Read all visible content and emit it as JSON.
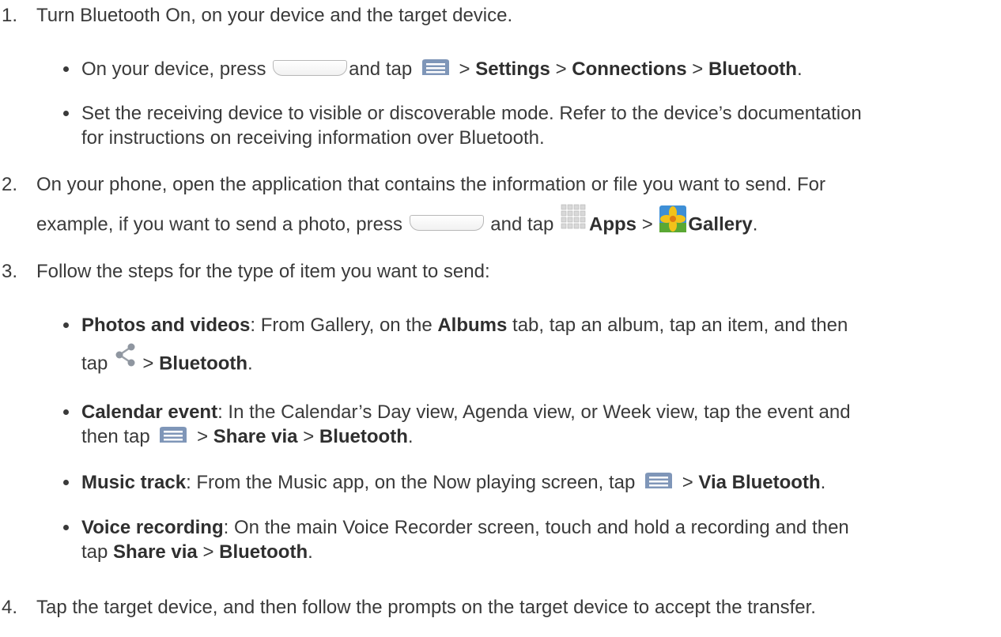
{
  "steps": [
    {
      "num": "1.",
      "text": "Turn Bluetooth On, on your device and the target device."
    },
    {
      "num": "2.",
      "line1": "On your phone, open the application that contains the information or file you want to send. For",
      "line2_a": "example, if you want to send a photo, press",
      "line2_b": "and tap",
      "apps": "Apps",
      "sep": ">",
      "gallery": "Gallery",
      "end": "."
    },
    {
      "num": "3.",
      "text": "Follow the steps for the type of item you want to send:"
    },
    {
      "num": "4.",
      "text": "Tap the target device, and then follow the prompts on the target device to accept the transfer."
    }
  ],
  "step1_bullets": {
    "b1": {
      "a": "On your device, press",
      "b": "and tap",
      "c": ">",
      "settings": "Settings",
      "d": ">",
      "connections": "Connections",
      "e": ">",
      "bluetooth": "Bluetooth",
      "f": "."
    },
    "b2": {
      "line1": "Set the receiving device to visible or discoverable mode. Refer to the device’s documentation",
      "line2": "for instructions on receiving information over Bluetooth."
    }
  },
  "step3_bullets": {
    "photos": {
      "label": "Photos and videos",
      "a": ": From Gallery, on the",
      "albums": "Albums",
      "b": "tab, tap an album, tap an item, and then",
      "c": "tap",
      "d": ">",
      "bluetooth": "Bluetooth",
      "e": "."
    },
    "calendar": {
      "label": "Calendar event",
      "a": ": In the Calendar’s Day view, Agenda view, or Week view, tap the event and",
      "b": "then tap",
      "c": ">",
      "share": "Share via",
      "d": ">",
      "bluetooth": "Bluetooth",
      "e": "."
    },
    "music": {
      "label": "Music track",
      "a": ": From the Music app, on the Now playing screen, tap",
      "b": ">",
      "via": "Via Bluetooth",
      "c": "."
    },
    "voice": {
      "label": "Voice recording",
      "a": ": On the main Voice Recorder screen, touch and hold a recording and then",
      "b": "tap",
      "share": "Share via",
      "c": ">",
      "bluetooth": "Bluetooth",
      "d": "."
    }
  },
  "icons": {
    "home_key": "home-key-icon",
    "menu": "menu-icon",
    "apps": "apps-grid-icon",
    "gallery": "gallery-icon",
    "share": "share-icon"
  }
}
